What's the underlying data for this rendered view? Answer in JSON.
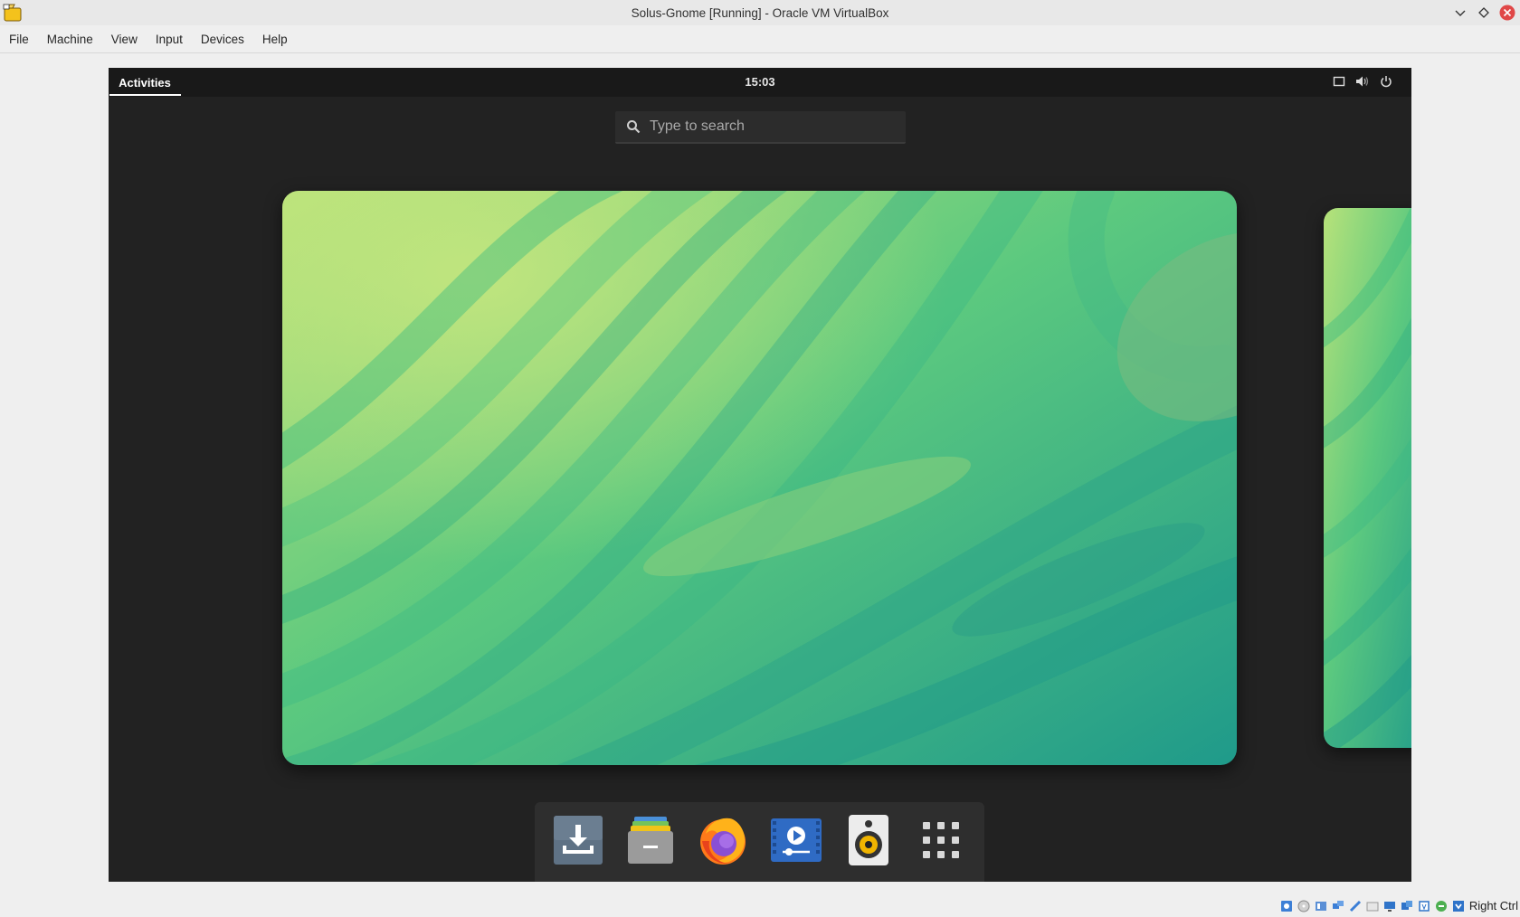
{
  "window": {
    "title": "Solus-Gnome [Running] - Oracle VM VirtualBox"
  },
  "menubar": {
    "items": [
      "File",
      "Machine",
      "View",
      "Input",
      "Devices",
      "Help"
    ]
  },
  "gnome": {
    "activities_label": "Activities",
    "clock": "15:03",
    "status_icons": [
      "screen-icon",
      "volume-icon",
      "power-icon"
    ],
    "search": {
      "placeholder": "Type to search",
      "value": ""
    },
    "dash": {
      "apps": [
        "downloader",
        "files",
        "firefox",
        "video-player",
        "rhythmbox",
        "show-applications"
      ]
    }
  },
  "statusbar": {
    "host_key": "Right Ctrl"
  },
  "colors": {
    "vm_bg": "#222222",
    "topbar": "#191919",
    "wallpaper_light": "#b7e27a",
    "wallpaper_mid": "#5cc97f",
    "wallpaper_dark": "#1f9a8a"
  }
}
